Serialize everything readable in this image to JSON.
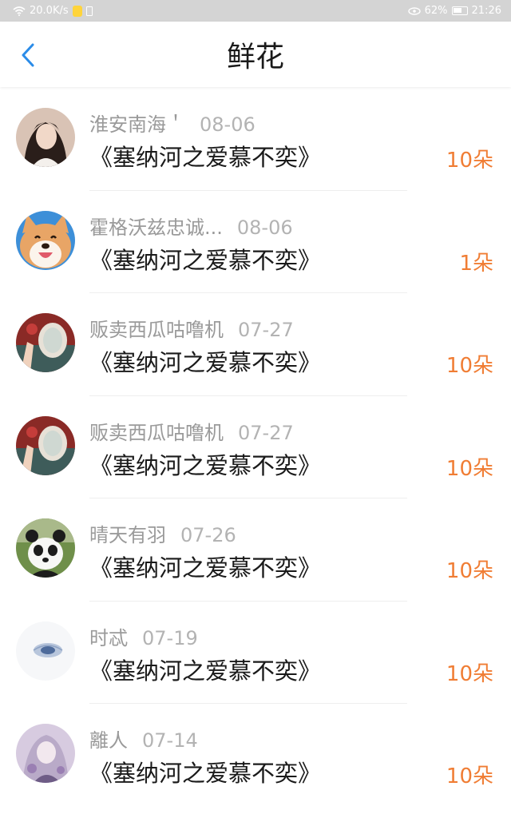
{
  "status_bar": {
    "speed": "20.0K/s",
    "battery": "62%",
    "time": "21:26"
  },
  "header": {
    "title": "鲜花"
  },
  "items": [
    {
      "name": "淮安南海＇",
      "date": "08-06",
      "gift": "《塞纳河之爱慕不奕》",
      "count": "10朵"
    },
    {
      "name": "霍格沃兹忠诚...",
      "date": "08-06",
      "gift": "《塞纳河之爱慕不奕》",
      "count": "1朵"
    },
    {
      "name": "贩卖西瓜咕噜机",
      "date": "07-27",
      "gift": "《塞纳河之爱慕不奕》",
      "count": "10朵"
    },
    {
      "name": "贩卖西瓜咕噜机",
      "date": "07-27",
      "gift": "《塞纳河之爱慕不奕》",
      "count": "10朵"
    },
    {
      "name": "晴天有羽",
      "date": "07-26",
      "gift": "《塞纳河之爱慕不奕》",
      "count": "10朵"
    },
    {
      "name": "时忒",
      "date": "07-19",
      "gift": "《塞纳河之爱慕不奕》",
      "count": "10朵"
    },
    {
      "name": "離人",
      "date": "07-14",
      "gift": "《塞纳河之爱慕不奕》",
      "count": "10朵"
    }
  ],
  "colors": {
    "accent": "#2b8ce8",
    "count": "#f07d34",
    "status_bar_bg": "#d4d4d4"
  }
}
